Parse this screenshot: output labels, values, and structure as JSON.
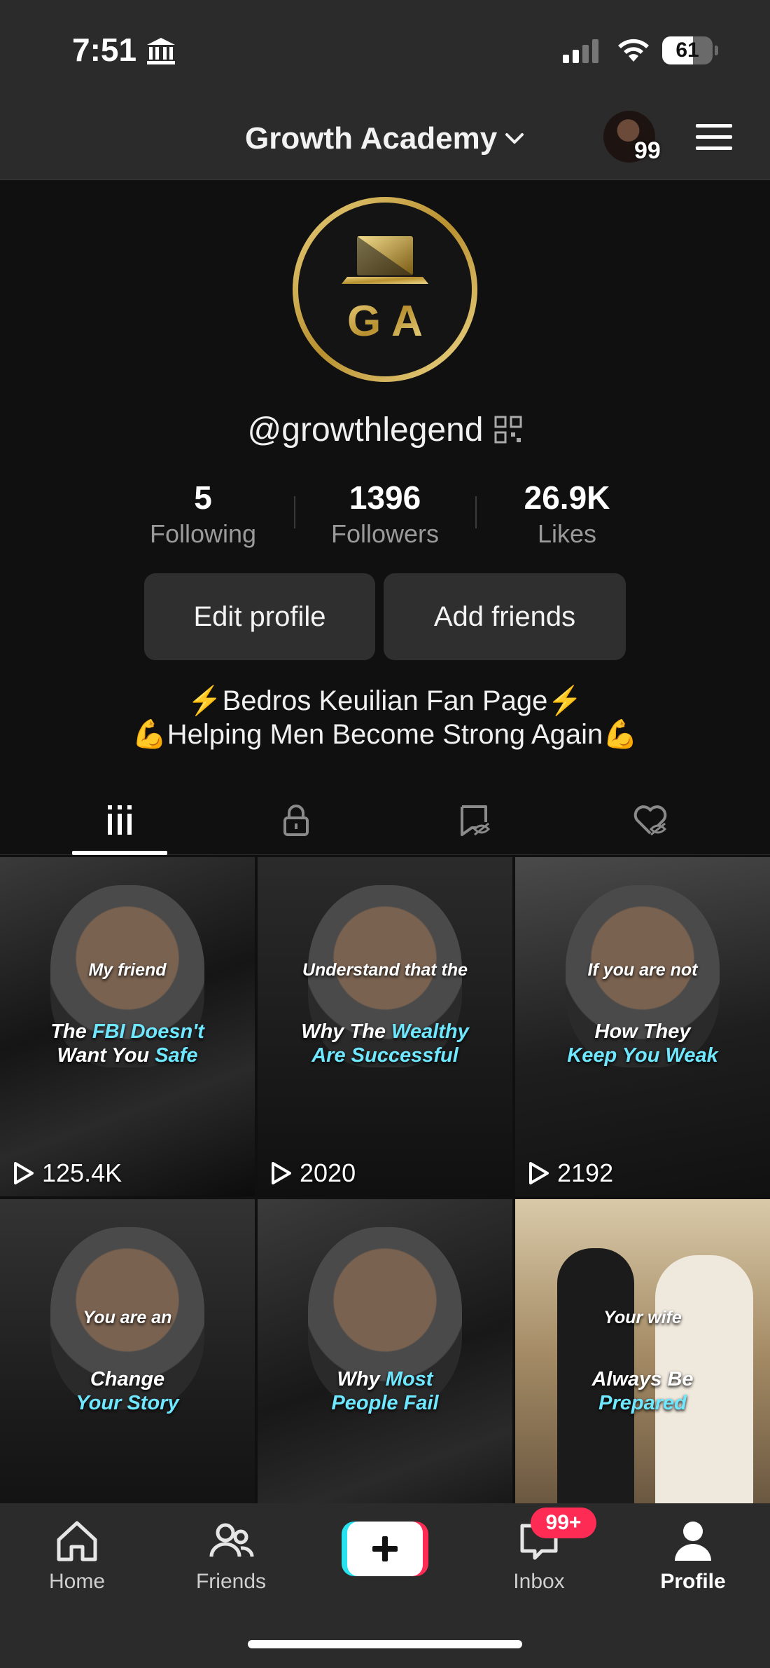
{
  "status_bar": {
    "time": "7:51",
    "battery_level": 61,
    "battery_label": "61",
    "icons": [
      "bank-icon",
      "cellular-signal-icon",
      "wifi-icon",
      "battery-icon"
    ]
  },
  "header": {
    "account_name": "Growth Academy",
    "avatar_badge": "99",
    "icons": [
      "chevron-down-icon",
      "menu-icon"
    ]
  },
  "profile": {
    "avatar_text": "G A",
    "handle": "@growthlegend",
    "stats": [
      {
        "value": "5",
        "label": "Following"
      },
      {
        "value": "1396",
        "label": "Followers"
      },
      {
        "value": "26.9K",
        "label": "Likes"
      }
    ],
    "buttons": {
      "edit": "Edit profile",
      "add_friends": "Add friends"
    },
    "bio": [
      "⚡️Bedros Keuilian Fan Page⚡️",
      "💪Helping Men Become Strong Again💪"
    ]
  },
  "tabs": [
    {
      "icon": "videos-grid-icon",
      "active": true
    },
    {
      "icon": "private-lock-icon",
      "active": false
    },
    {
      "icon": "reposts-hidden-icon",
      "active": false
    },
    {
      "icon": "liked-hidden-icon",
      "active": false
    }
  ],
  "videos": [
    {
      "caption_top": "My friend",
      "caption_line1": [
        [
          "The ",
          "w"
        ],
        [
          "FBI Doesn't",
          "c"
        ]
      ],
      "caption_line2": [
        [
          "Want You ",
          "w"
        ],
        [
          "Safe",
          "c"
        ]
      ],
      "views": "125.4K"
    },
    {
      "caption_top": "Understand that the",
      "caption_line1": [
        [
          "Why The ",
          "w"
        ],
        [
          "Wealthy",
          "c"
        ]
      ],
      "caption_line2": [
        [
          "Are Successful",
          "c"
        ]
      ],
      "views": "2020"
    },
    {
      "caption_top": "If you are not",
      "caption_line1": [
        [
          "How They",
          "w"
        ]
      ],
      "caption_line2": [
        [
          "Keep You Weak",
          "c"
        ]
      ],
      "views": "2192"
    },
    {
      "caption_top": "You are an",
      "caption_line1": [
        [
          "Change",
          "w"
        ]
      ],
      "caption_line2": [
        [
          "Your Story",
          "c"
        ]
      ],
      "views": ""
    },
    {
      "caption_top": "",
      "caption_line1": [
        [
          "Why ",
          "w"
        ],
        [
          "Most",
          "c"
        ]
      ],
      "caption_line2": [
        [
          "People Fail",
          "c"
        ]
      ],
      "views": ""
    },
    {
      "caption_top": "Your wife",
      "caption_line1": [
        [
          "Always Be",
          "w"
        ]
      ],
      "caption_line2": [
        [
          "Prepared",
          "c"
        ]
      ],
      "views": ""
    }
  ],
  "bottom_nav": {
    "items": [
      {
        "label": "Home",
        "icon": "home-icon"
      },
      {
        "label": "Friends",
        "icon": "friends-icon"
      },
      {
        "label": "",
        "icon": "create-plus-icon"
      },
      {
        "label": "Inbox",
        "icon": "inbox-icon"
      },
      {
        "label": "Profile",
        "icon": "profile-icon"
      }
    ],
    "inbox_badge": "99+"
  },
  "colors": {
    "background": "#101010",
    "bar": "#2b2b2b",
    "button": "#2f2f2f",
    "caption_accent": "#6ee7ff",
    "badge": "#fe2c55",
    "create_cyan": "#27e3f0",
    "gold": "#c9a24a"
  }
}
